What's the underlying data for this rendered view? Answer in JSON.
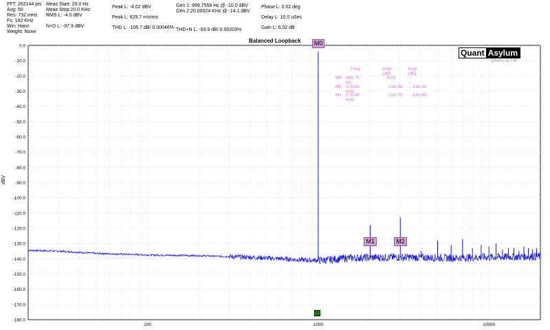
{
  "header": {
    "col1": [
      "FFT: 262144 pts",
      "Avg: 50",
      "Res: 732 mHz",
      "Fs: 192 KHz",
      "Win: Hann",
      "Weight: None"
    ],
    "col2": [
      "Meas Start: 20.0 Hz",
      "Meas Stop:20.0 KHz",
      "RMS L: -4.0 dBV",
      "",
      "N+D L: -97.9 dBV"
    ],
    "col3": [
      "Peak L: -4.02 dBV",
      "",
      "Peak L: 629.7 mVrms",
      "",
      "THD L: -106.7 dB/ 0.00046%"
    ],
    "col4": [
      "Gen 1: 999.7558 Hz @ -10.0  dBV",
      "Gen 2:20.00024 KHz @ -14.1  dBV",
      "",
      "",
      "THD+N L: -93.9 dB/ 0.00203%"
    ],
    "col5": [
      "Phase L: 0.02 deg",
      "",
      "Delay L: 10.0 uSec",
      "",
      "Gain L: 6.02 dB"
    ]
  },
  "brand": {
    "quant": "Quant",
    "asylum": "Asylum",
    "version": "QA401 v1.740"
  },
  "marker_table": {
    "headers": [
      "Freq",
      "Amp (dB)",
      "Amp (dB)"
    ],
    "rows": [
      {
        "marker": "M0",
        "freq": "999.75 Hz",
        "amp1": "-4.02",
        "amp2": "---"
      },
      {
        "marker": "M2",
        "freq": "3.0241 KHz",
        "amp1": "-138.36",
        "amp2": "-134.34"
      },
      {
        "marker": "M1",
        "freq": "2.0148 KHz",
        "amp1": "-138.70",
        "amp2": "-134.68"
      }
    ]
  },
  "chart_data": {
    "type": "line",
    "title": "Balanced Loopback",
    "ylabel": "dBV",
    "xlabel": "",
    "xscale": "log",
    "xlim": [
      20,
      20000
    ],
    "ylim": [
      -180,
      0
    ],
    "yticks": [
      0,
      -10,
      -20,
      -30,
      -40,
      -50,
      -60,
      -70,
      -80,
      -90,
      -100,
      -110,
      -120,
      -130,
      -140,
      -150,
      -160,
      -170,
      -180
    ],
    "ytick_labels": [
      "0.0",
      "-10.0",
      "-20.0",
      "-30.0",
      "-40.0",
      "-50.0",
      "-60.0",
      "-70.0",
      "-80.0",
      "-90.0",
      "-100.0",
      "-110.0",
      "-120.0",
      "-130.0",
      "-140.0",
      "-150.0",
      "-160.0",
      "-170.0",
      "-180.0"
    ],
    "xticks": [
      100,
      1000,
      10000
    ],
    "xtick_labels": [
      "100",
      "1000",
      "10000"
    ],
    "grid": true,
    "series_color": "#1010e0",
    "noise_floor": [
      {
        "x": 20,
        "y": -134.5
      },
      {
        "x": 30,
        "y": -135.0
      },
      {
        "x": 50,
        "y": -136.5
      },
      {
        "x": 100,
        "y": -137.5
      },
      {
        "x": 200,
        "y": -138.0
      },
      {
        "x": 400,
        "y": -139.0
      },
      {
        "x": 900,
        "y": -141.0
      },
      {
        "x": 1100,
        "y": -141.0
      },
      {
        "x": 1500,
        "y": -139.5
      },
      {
        "x": 3000,
        "y": -139.0
      },
      {
        "x": 6000,
        "y": -139.5
      },
      {
        "x": 10000,
        "y": -139.0
      },
      {
        "x": 20000,
        "y": -138.5
      }
    ],
    "peaks": [
      {
        "x": 999.75,
        "y": -4.02
      },
      {
        "x": 2014.8,
        "y": -118.0
      },
      {
        "x": 3024.1,
        "y": -113.0
      },
      {
        "x": 4000,
        "y": -135.0
      },
      {
        "x": 5000,
        "y": -128.0
      },
      {
        "x": 6000,
        "y": -131.0
      },
      {
        "x": 7000,
        "y": -127.0
      },
      {
        "x": 8000,
        "y": -133.0
      },
      {
        "x": 9000,
        "y": -131.0
      },
      {
        "x": 10000,
        "y": -132.0
      },
      {
        "x": 11000,
        "y": -130.0
      },
      {
        "x": 12000,
        "y": -134.0
      },
      {
        "x": 13000,
        "y": -133.0
      },
      {
        "x": 14000,
        "y": -133.0
      },
      {
        "x": 15000,
        "y": -135.0
      },
      {
        "x": 16000,
        "y": -132.0
      },
      {
        "x": 17000,
        "y": -133.0
      },
      {
        "x": 18000,
        "y": -134.0
      },
      {
        "x": 19000,
        "y": -133.0
      }
    ],
    "markers": [
      {
        "name": "M0",
        "x": 999.75,
        "y": -4.02
      },
      {
        "name": "M1",
        "x": 2014.8,
        "y": -138.7
      },
      {
        "name": "M2",
        "x": 3024.1,
        "y": -138.36
      }
    ]
  }
}
